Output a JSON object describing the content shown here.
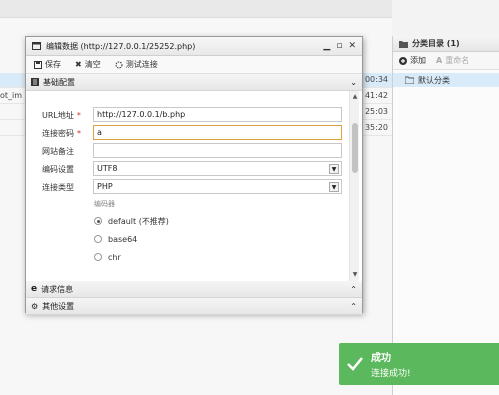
{
  "background": {
    "rows": [
      {
        "left": "",
        "right": "00:34",
        "selected": true
      },
      {
        "left": "ot_im",
        "right": "41:42",
        "selected": false
      },
      {
        "left": "",
        "right": "25:03",
        "selected": false
      },
      {
        "left": "",
        "right": "35:20",
        "selected": false
      }
    ]
  },
  "category_panel": {
    "title": "分类目录 (1)",
    "add_label": "添加",
    "rename_label": "重命名",
    "items": [
      {
        "label": "默认分类"
      }
    ]
  },
  "dialog": {
    "title": "编辑数据 (http://127.0.0.1/25252.php)",
    "toolbar": {
      "save": "保存",
      "clear": "清空",
      "test": "测试连接"
    },
    "section_basic": "基础配置",
    "fields": {
      "url_label": "URL地址",
      "url_value": "http://127.0.0.1/b.php",
      "password_label": "连接密码",
      "password_value": "a",
      "note_label": "网站备注",
      "note_value": "",
      "encoding_label": "编码设置",
      "encoding_value": "UTF8",
      "type_label": "连接类型",
      "type_value": "PHP"
    },
    "encoder": {
      "label": "编码器",
      "options": [
        {
          "label": "default (不推荐)",
          "checked": true
        },
        {
          "label": "base64",
          "checked": false
        },
        {
          "label": "chr",
          "checked": false
        }
      ]
    },
    "section_request": "请求信息",
    "section_other": "其他设置"
  },
  "toast": {
    "title": "成功",
    "message": "连接成功!",
    "color": "#5cb85c"
  }
}
